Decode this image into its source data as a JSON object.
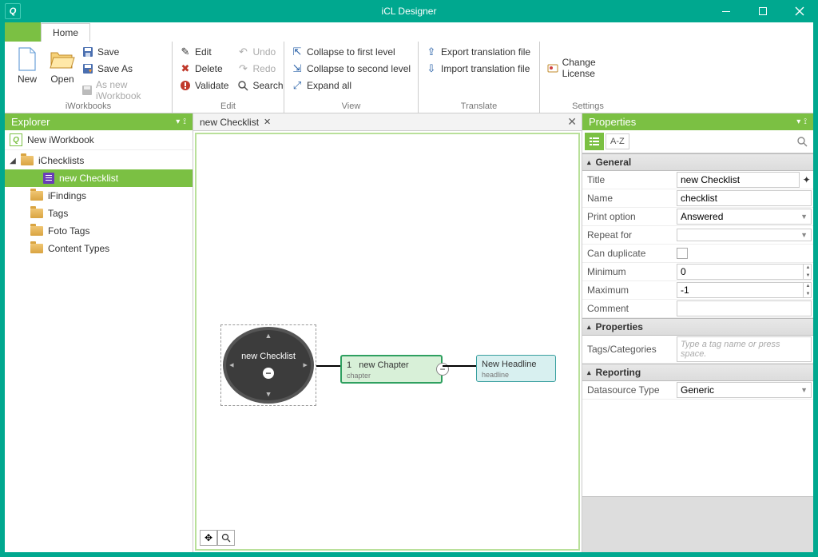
{
  "app": {
    "title": "iCL Designer"
  },
  "menu": {
    "home": "Home"
  },
  "ribbon": {
    "iworkbooks": {
      "label": "iWorkbooks",
      "new": "New",
      "open": "Open",
      "save": "Save",
      "save_as": "Save As",
      "as_new": "As new iWorkbook"
    },
    "edit": {
      "label": "Edit",
      "edit": "Edit",
      "delete": "Delete",
      "validate": "Validate",
      "undo": "Undo",
      "redo": "Redo",
      "search": "Search"
    },
    "view": {
      "label": "View",
      "collapse_first": "Collapse to first level",
      "collapse_second": "Collapse to second level",
      "expand_all": "Expand all"
    },
    "translate": {
      "label": "Translate",
      "export_tr": "Export translation file",
      "import_tr": "Import translation file"
    },
    "settings": {
      "label": "Settings",
      "change_license": "Change License"
    }
  },
  "explorer": {
    "title": "Explorer",
    "root": "New iWorkbook",
    "items": {
      "ichecklists": "iChecklists",
      "new_checklist": "new Checklist",
      "ifindings": "iFindings",
      "tags": "Tags",
      "foto_tags": "Foto Tags",
      "content_types": "Content Types"
    }
  },
  "document": {
    "tab": "new Checklist",
    "canvas": {
      "checklist_node": "new Checklist",
      "chapter_num": "1",
      "chapter_title": "new Chapter",
      "chapter_sub": "chapter",
      "headline_title": "New Headline",
      "headline_sub": "headline"
    }
  },
  "properties": {
    "title": "Properties",
    "sort": "A-Z",
    "groups": {
      "general": "General",
      "properties": "Properties",
      "reporting": "Reporting"
    },
    "general": {
      "title_label": "Title",
      "title_value": "new Checklist",
      "name_label": "Name",
      "name_value": "checklist",
      "print_label": "Print option",
      "print_value": "Answered",
      "repeat_label": "Repeat for",
      "repeat_value": "",
      "dup_label": "Can duplicate",
      "min_label": "Minimum",
      "min_value": "0",
      "max_label": "Maximum",
      "max_value": "-1",
      "comment_label": "Comment",
      "comment_value": ""
    },
    "props": {
      "tags_label": "Tags/Categories",
      "tags_placeholder": "Type a tag name or press space."
    },
    "reporting": {
      "ds_label": "Datasource Type",
      "ds_value": "Generic"
    }
  }
}
